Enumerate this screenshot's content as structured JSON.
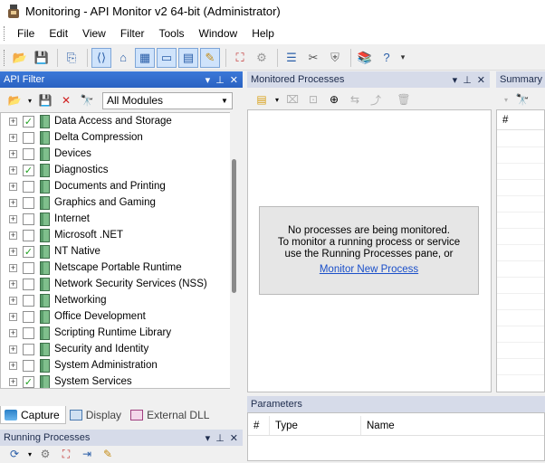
{
  "window": {
    "title": "Monitoring - API Monitor v2 64-bit (Administrator)"
  },
  "menu": [
    "File",
    "Edit",
    "View",
    "Filter",
    "Tools",
    "Window",
    "Help"
  ],
  "toolbar_icons": [
    "open-icon",
    "save-icon",
    "copy-icon",
    "capture-icon",
    "filter-icon",
    "layout-icon",
    "window-icon",
    "window-split-icon",
    "notes-icon",
    "monitor-icon",
    "process-icon",
    "list-icon",
    "tools-icon",
    "shield-icon",
    "books-icon",
    "help-doc-icon",
    "toolbar-options-icon"
  ],
  "api_filter": {
    "header": "API Filter",
    "module_select": "All Modules",
    "items": [
      {
        "label": "Data Access and Storage",
        "checked": true
      },
      {
        "label": "Delta Compression",
        "checked": false
      },
      {
        "label": "Devices",
        "checked": false
      },
      {
        "label": "Diagnostics",
        "checked": true
      },
      {
        "label": "Documents and Printing",
        "checked": false
      },
      {
        "label": "Graphics and Gaming",
        "checked": false
      },
      {
        "label": "Internet",
        "checked": false
      },
      {
        "label": "Microsoft .NET",
        "checked": false
      },
      {
        "label": "NT Native",
        "checked": true
      },
      {
        "label": "Netscape Portable Runtime",
        "checked": false
      },
      {
        "label": "Network Security Services (NSS)",
        "checked": false
      },
      {
        "label": "Networking",
        "checked": false
      },
      {
        "label": "Office Development",
        "checked": false
      },
      {
        "label": "Scripting Runtime Library",
        "checked": false
      },
      {
        "label": "Security and Identity",
        "checked": false
      },
      {
        "label": "System Administration",
        "checked": false
      },
      {
        "label": "System Services",
        "checked": true
      }
    ],
    "tabs": [
      "Capture",
      "Display",
      "External DLL"
    ]
  },
  "monitored": {
    "header": "Monitored Processes",
    "message_line1": "No processes are being monitored.",
    "message_line2": "To monitor a running process or service",
    "message_line3": "use the Running Processes pane, or",
    "link": "Monitor New Process"
  },
  "summary": {
    "header": "Summary",
    "col": "#"
  },
  "parameters": {
    "header": "Parameters",
    "cols": [
      "#",
      "Type",
      "Name"
    ]
  },
  "running": {
    "header": "Running Processes"
  }
}
